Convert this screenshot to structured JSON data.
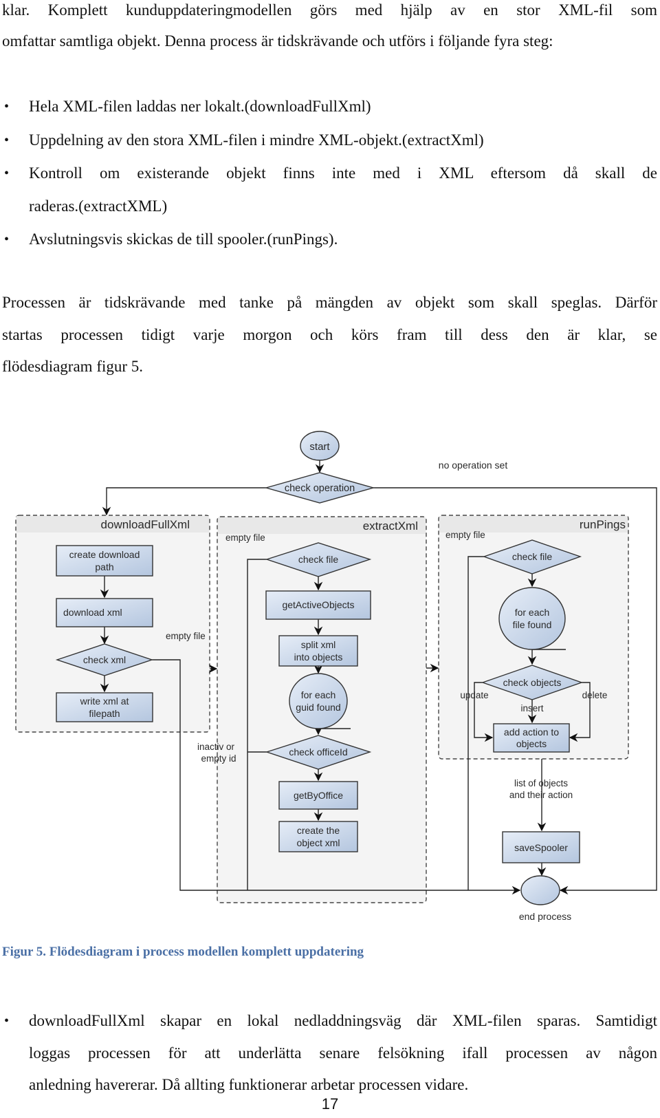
{
  "intro": {
    "lines": [
      "klar. Komplett kunduppdateringmodellen görs med hjälp av en stor XML-fil som",
      "omfattar samtliga objekt. Denna process är tidskrävande och utförs i följande fyra steg:"
    ]
  },
  "steps": [
    {
      "lines": [
        "Hela XML-filen laddas ner lokalt.(downloadFullXml)"
      ]
    },
    {
      "lines": [
        "Uppdelning av den stora XML-filen i mindre XML-objekt.(extractXml)"
      ]
    },
    {
      "lines": [
        "Kontroll om existerande objekt finns inte med i XML eftersom då skall de",
        "raderas.(extractXML)"
      ]
    },
    {
      "lines": [
        "Avslutningsvis skickas de till spooler.(runPings)."
      ]
    }
  ],
  "paragraph": {
    "lines": [
      "Processen är tidskrävande med tanke på mängden av objekt som skall speglas. Därför",
      "startas processen tidigt varje morgon och körs fram till dess den är klar, se",
      "flödesdiagram figur 5."
    ]
  },
  "diagram": {
    "start": "start",
    "check_operation": "check operation",
    "no_operation_label": "no operation set",
    "end_label": "end process",
    "lanes": {
      "download": {
        "title": "downloadFullXml",
        "create_path": [
          "create download",
          "path"
        ],
        "download_xml": "download xml",
        "check_xml": "check xml",
        "write_xml": [
          "write xml at",
          "filepath"
        ],
        "empty_file": "empty file"
      },
      "extract": {
        "title": "extractXml",
        "empty_file": "empty file",
        "check_file": "check file",
        "get_active": "getActiveObjects",
        "split_xml": [
          "split xml",
          "into objects"
        ],
        "for_each_guid": [
          "for each",
          "guid found"
        ],
        "check_office": "check officeId",
        "inactive_label": [
          "inactiv or",
          "empty id"
        ],
        "get_by_office": "getByOffice",
        "create_object": [
          "create the",
          "object xml"
        ]
      },
      "pings": {
        "title": "runPings",
        "empty_file": "empty file",
        "check_file": "check file",
        "for_each_file": [
          "for each",
          "file found"
        ],
        "check_objects": "check objects",
        "update": "update",
        "insert": "insert",
        "delete": "delete",
        "add_action": [
          "add action to",
          "objects"
        ],
        "list_label": [
          "list of objects",
          "and their action"
        ],
        "save_spooler": "saveSpooler"
      }
    },
    "colors": {
      "node_fill_light": "#e4ecf6",
      "node_fill_dark": "#b7c9e2",
      "stroke": "#333333",
      "lane_fill": "#f4f4f4",
      "lane_header": "#e9e9e9"
    }
  },
  "caption": "Figur 5. Flödesdiagram i process modellen komplett uppdatering",
  "bottom_bullet": {
    "lines": [
      "downloadFullXml skapar en lokal nedladdningsväg där XML-filen sparas. Samtidigt",
      "loggas processen för att underlätta senare felsökning ifall processen av någon",
      "anledning havererar. Då allting funktionerar arbetar processen vidare."
    ]
  },
  "page_number": "17"
}
